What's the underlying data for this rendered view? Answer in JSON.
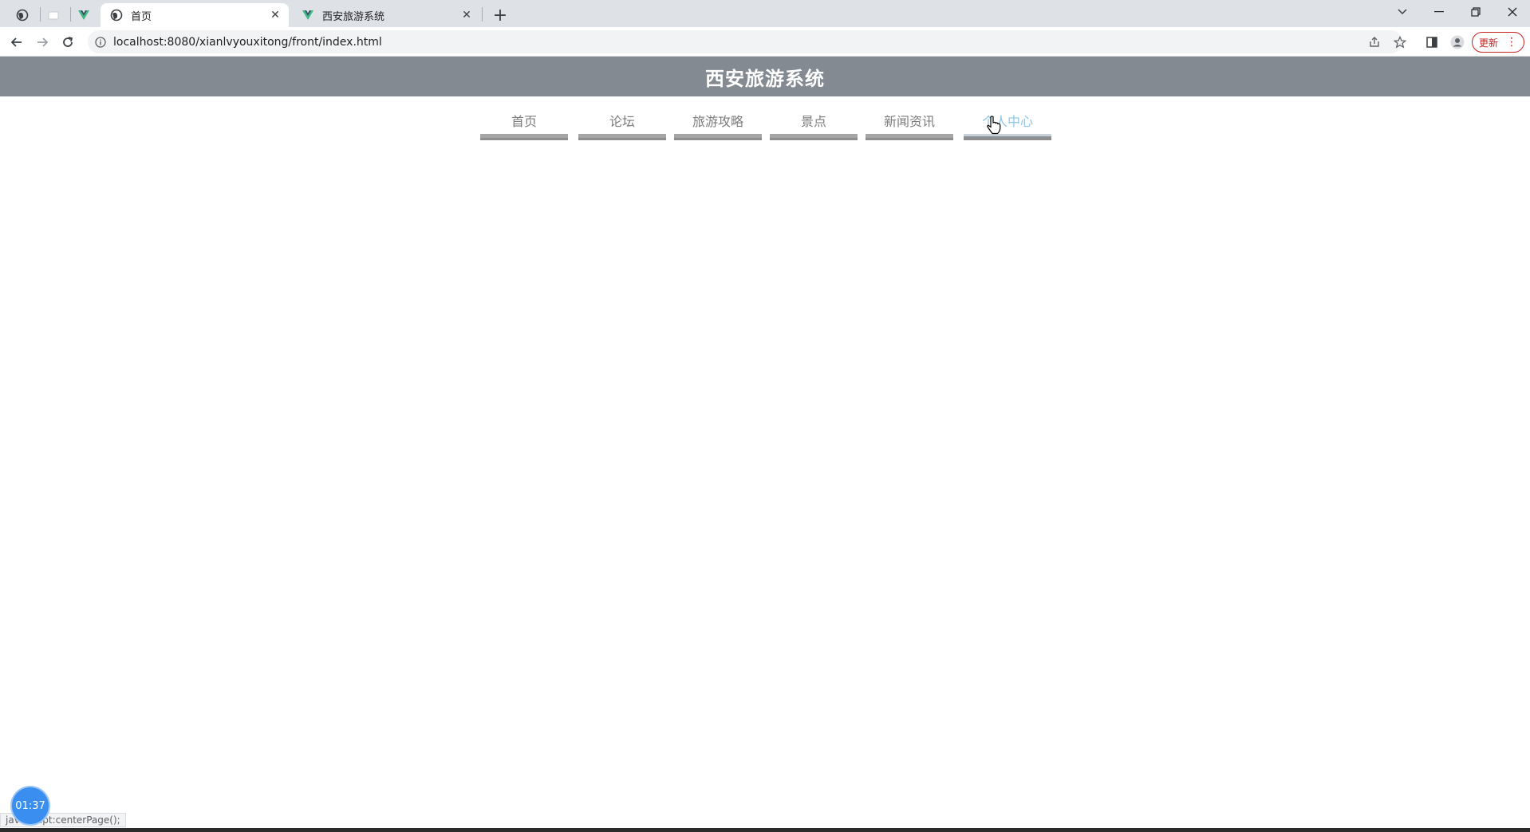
{
  "browser": {
    "tabs": [
      {
        "label": "首页",
        "active": true
      },
      {
        "label": "西安旅游系统",
        "active": false
      }
    ],
    "url": "localhost:8080/xianlvyouxitong/front/index.html",
    "update_label": "更新",
    "status_url": "javascript:centerPage();",
    "accent_update": "#c5221f"
  },
  "site": {
    "title": "西安旅游系统",
    "header_color": "#838a92",
    "nav": [
      {
        "label": "首页"
      },
      {
        "label": "论坛"
      },
      {
        "label": "旅游攻略"
      },
      {
        "label": "景点"
      },
      {
        "label": "新闻资讯"
      },
      {
        "label": "个人中心",
        "hovered": true
      }
    ]
  },
  "overlay": {
    "timer": "01:37"
  }
}
